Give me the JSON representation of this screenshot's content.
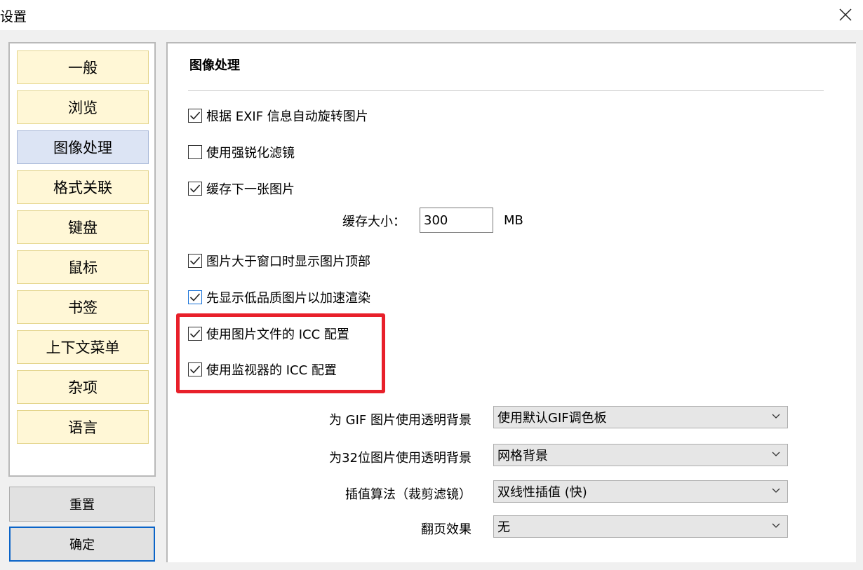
{
  "window": {
    "title": "设置"
  },
  "nav": {
    "items": [
      {
        "label": "一般"
      },
      {
        "label": "浏览"
      },
      {
        "label": "图像处理",
        "active": true
      },
      {
        "label": "格式关联"
      },
      {
        "label": "键盘"
      },
      {
        "label": "鼠标"
      },
      {
        "label": "书签"
      },
      {
        "label": "上下文菜单"
      },
      {
        "label": "杂项"
      },
      {
        "label": "语言"
      }
    ]
  },
  "buttons": {
    "reset": "重置",
    "ok": "确定"
  },
  "content": {
    "section_title": "图像处理",
    "options": [
      {
        "label": "根据 EXIF 信息自动旋转图片",
        "checked": true
      },
      {
        "label": "使用强锐化滤镜",
        "checked": false
      },
      {
        "label": "缓存下一张图片",
        "checked": true
      },
      {
        "label": "图片大于窗口时显示图片顶部",
        "checked": true
      },
      {
        "label": "先显示低品质图片以加速渲染",
        "checked": true
      },
      {
        "label": "使用图片文件的 ICC 配置",
        "checked": true
      },
      {
        "label": "使用监视器的 ICC 配置",
        "checked": true
      }
    ],
    "cache": {
      "label": "缓存大小：",
      "value": "300",
      "unit": "MB"
    },
    "selects": [
      {
        "label": "为 GIF 图片使用透明背景",
        "value": "使用默认GIF调色板"
      },
      {
        "label": "为32位图片使用透明背景",
        "value": "网格背景"
      },
      {
        "label": "插值算法（裁剪滤镜）",
        "value": "双线性插值 (快)"
      },
      {
        "label": "翻页效果",
        "value": "无"
      }
    ]
  },
  "colors": {
    "nav_item_bg": "#fff7d6",
    "nav_item_active_bg": "#dce4f4",
    "highlight_border": "#e8202a",
    "primary_button_border": "#0a64c8"
  },
  "icons": {
    "close": "close-icon",
    "check": "checkmark-icon",
    "dropdown": "chevron-down-icon"
  }
}
